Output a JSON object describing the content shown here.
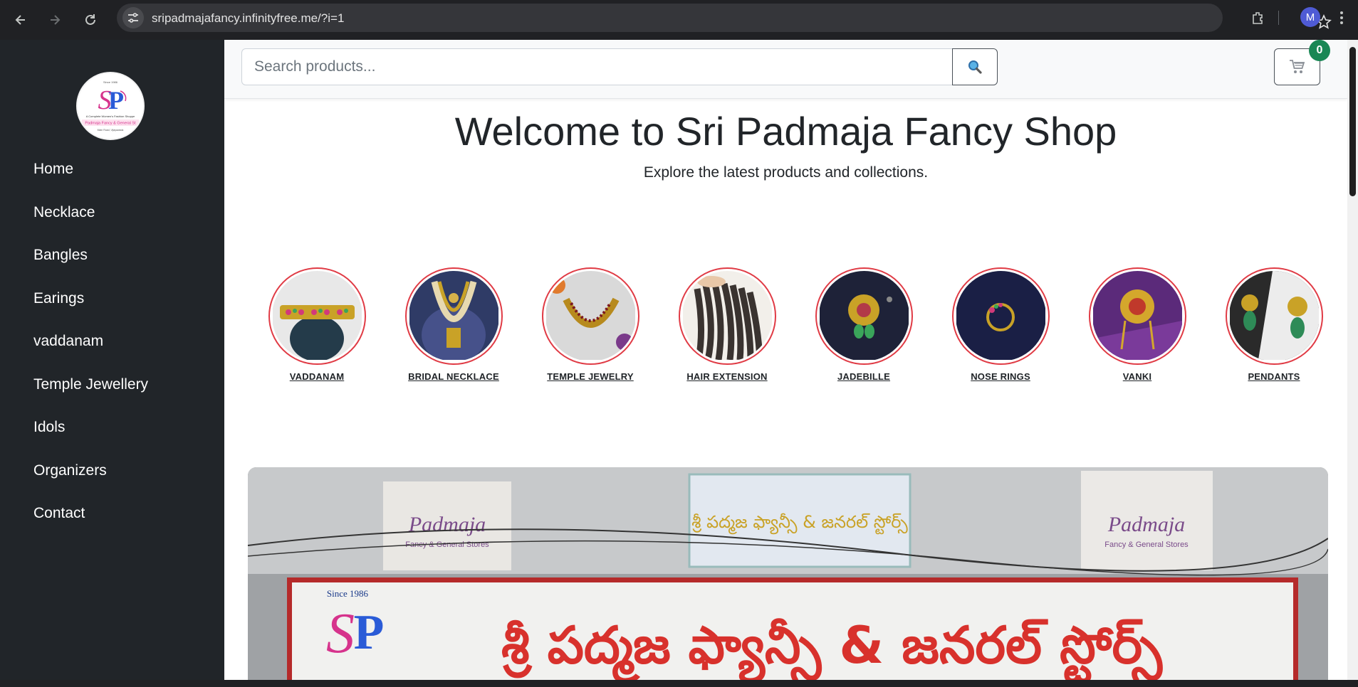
{
  "browser": {
    "url": "sripadmajafancy.infinityfree.me/?i=1",
    "avatar_letter": "M"
  },
  "sidebar": {
    "logo_alt": "Sri Padmaja Fancy & General Stores logo",
    "logo_text": {
      "tagline": "A Complete Women's Fashion Shoppe",
      "brand": "Padmaja Fancy & General Stores"
    },
    "items": [
      {
        "label": "Home"
      },
      {
        "label": "Necklace"
      },
      {
        "label": "Bangles"
      },
      {
        "label": "Earings"
      },
      {
        "label": "vaddanam"
      },
      {
        "label": "Temple Jewellery"
      },
      {
        "label": "Idols"
      },
      {
        "label": "Organizers"
      },
      {
        "label": "Contact"
      }
    ]
  },
  "topbar": {
    "search_placeholder": "Search products...",
    "cart_count": "0"
  },
  "hero": {
    "title": "Welcome to Sri Padmaja Fancy Shop",
    "subtitle": "Explore the latest products and collections."
  },
  "categories": [
    {
      "label": "VADDANAM"
    },
    {
      "label": "BRIDAL NECKLACE"
    },
    {
      "label": "TEMPLE JEWELRY"
    },
    {
      "label": "HAIR EXTENSION"
    },
    {
      "label": "JADEBILLE"
    },
    {
      "label": "NOSE RINGS"
    },
    {
      "label": "VANKI"
    },
    {
      "label": "PENDANTS"
    }
  ],
  "storefront": {
    "since_text": "Since 1986",
    "sign_left": "Padmaja",
    "sign_left_sub": "Fancy & General Stores",
    "sign_right": "Padmaja",
    "sign_right_sub": "Fancy & General Stores",
    "telugu_main": "శ్రీ పద్మజ ఫ్యాన్సీ & జనరల్ స్టోర్స్",
    "telugu_top": "శ్రీ పద్మజ ఫ్యాన్సీ & జనరల్ స్టోర్స్"
  },
  "colors": {
    "sidebar_bg": "#212529",
    "accent_ring": "#e03b45",
    "badge": "#198754"
  }
}
